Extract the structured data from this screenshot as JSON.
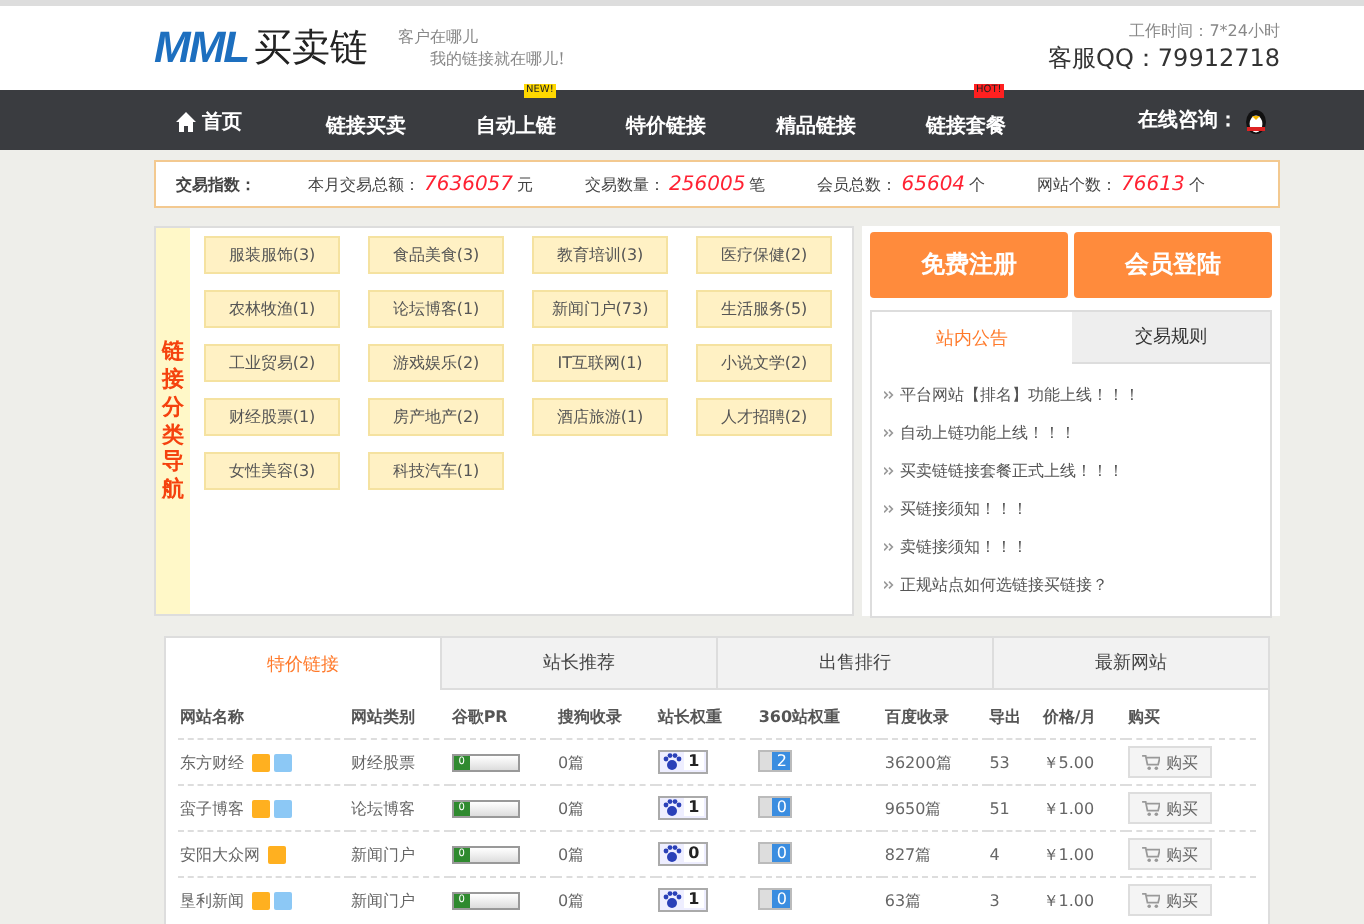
{
  "header": {
    "logo_text": "MML",
    "logo_name": "买卖链",
    "slogan_1": "客户在哪儿",
    "slogan_2": "我的链接就在哪儿!",
    "work_time": "工作时间：7*24小时",
    "qq": "客服QQ：79912718"
  },
  "nav": [
    {
      "label": "首页",
      "kind": "home"
    },
    {
      "label": "链接买卖",
      "kind": "plain"
    },
    {
      "label": "自动上链",
      "kind": "new",
      "badge": "NEW!"
    },
    {
      "label": "特价链接",
      "kind": "plain"
    },
    {
      "label": "精品链接",
      "kind": "plain"
    },
    {
      "label": "链接套餐",
      "kind": "hot",
      "badge": "HOT!"
    }
  ],
  "consult": "在线咨询：",
  "stats": {
    "title": "交易指数：",
    "items": [
      {
        "label": "本月交易总额：",
        "value": "7636057",
        "unit": "元"
      },
      {
        "label": "交易数量：",
        "value": "256005",
        "unit": "笔"
      },
      {
        "label": "会员总数：",
        "value": "65604",
        "unit": "个"
      },
      {
        "label": "网站个数：",
        "value": "76613",
        "unit": "个"
      }
    ]
  },
  "category_title": "链接分类导航",
  "categories": [
    "服装服饰(3)",
    "食品美食(3)",
    "教育培训(3)",
    "医疗保健(2)",
    "农林牧渔(1)",
    "论坛博客(1)",
    "新闻门户(73)",
    "生活服务(5)",
    "工业贸易(2)",
    "游戏娱乐(2)",
    "IT互联网(1)",
    "小说文学(2)",
    "财经股票(1)",
    "房产地产(2)",
    "酒店旅游(1)",
    "人才招聘(2)",
    "女性美容(3)",
    "科技汽车(1)"
  ],
  "buttons": [
    "免费注册",
    "会员登陆"
  ],
  "notice_tabs": [
    {
      "label": "站内公告",
      "selected": true
    },
    {
      "label": "交易规则",
      "selected": false
    }
  ],
  "notices": [
    "平台网站【排名】功能上线！！！",
    "自动上链功能上线！！！",
    "买卖链链接套餐正式上线！！！",
    "买链接须知！！！",
    "卖链接须知！！！",
    "正规站点如何选链接买链接？"
  ],
  "table_tabs": [
    {
      "label": "特价链接",
      "selected": true
    },
    {
      "label": "站长推荐",
      "selected": false
    },
    {
      "label": "出售排行",
      "selected": false
    },
    {
      "label": "最新网站",
      "selected": false
    }
  ],
  "table": {
    "columns": [
      "网站名称",
      "网站类别",
      "谷歌PR",
      "搜狗收录",
      "站长权重",
      "360站权重",
      "百度收录",
      "导出",
      "价格/月",
      "购买"
    ],
    "rows": [
      {
        "name": "东方财经",
        "blue_badge": true,
        "category": "财经股票",
        "pr": "0",
        "sogou": "0篇",
        "baidu_weight": "1",
        "so_weight": "2",
        "baidu_index": "36200篇",
        "export": "53",
        "price": "￥5.00",
        "buy": "购买"
      },
      {
        "name": "蛮子博客",
        "blue_badge": true,
        "category": "论坛博客",
        "pr": "0",
        "sogou": "0篇",
        "baidu_weight": "1",
        "so_weight": "0",
        "baidu_index": "9650篇",
        "export": "51",
        "price": "￥1.00",
        "buy": "购买"
      },
      {
        "name": "安阳大众网",
        "blue_badge": false,
        "category": "新闻门户",
        "pr": "0",
        "sogou": "0篇",
        "baidu_weight": "0",
        "so_weight": "0",
        "baidu_index": "827篇",
        "export": "4",
        "price": "￥1.00",
        "buy": "购买"
      },
      {
        "name": "垦利新闻",
        "blue_badge": true,
        "category": "新闻门户",
        "pr": "0",
        "sogou": "0篇",
        "baidu_weight": "1",
        "so_weight": "0",
        "baidu_index": "63篇",
        "export": "3",
        "price": "￥1.00",
        "buy": "购买"
      }
    ]
  }
}
